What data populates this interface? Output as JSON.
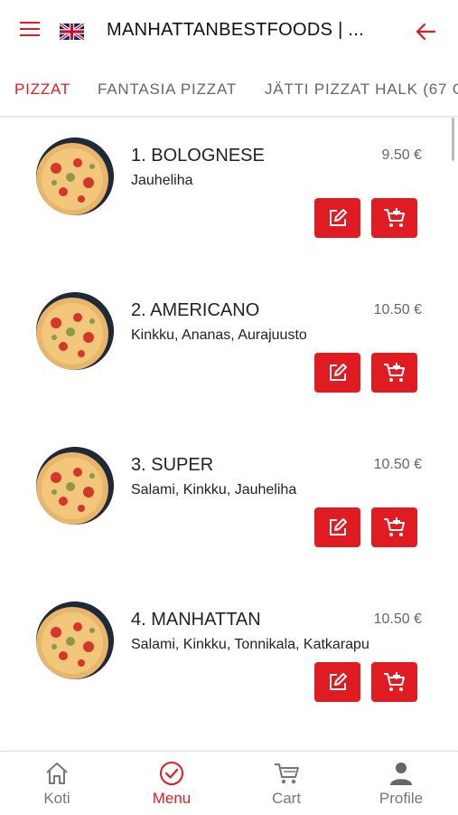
{
  "header": {
    "title": "MANHATTANBESTFOODS | ...",
    "menu_icon": "hamburger-icon",
    "language_icon": "uk-flag-icon",
    "back_icon": "arrow-left-icon"
  },
  "tabs": [
    {
      "label": "PIZZAT",
      "active": true
    },
    {
      "label": "FANTASIA PIZZAT",
      "active": false
    },
    {
      "label": "JÄTTI PIZZAT HALK (67 C",
      "active": false
    }
  ],
  "items": [
    {
      "name": "1. BOLOGNESE",
      "price": "9.50 €",
      "description": "Jauheliha"
    },
    {
      "name": "2. AMERICANO",
      "price": "10.50 €",
      "description": "Kinkku, Ananas, Aurajuusto"
    },
    {
      "name": "3. SUPER",
      "price": "10.50 €",
      "description": "Salami, Kinkku, Jauheliha"
    },
    {
      "name": "4. MANHATTAN",
      "price": "10.50 €",
      "description": "Salami, Kinkku, Tonnikala, Katkarapu"
    }
  ],
  "bottom_nav": [
    {
      "label": "Koti",
      "icon": "home-icon",
      "active": false
    },
    {
      "label": "Menu",
      "icon": "check-circle-icon",
      "active": true
    },
    {
      "label": "Cart",
      "icon": "cart-icon",
      "active": false
    },
    {
      "label": "Profile",
      "icon": "person-icon",
      "active": false
    }
  ],
  "colors": {
    "accent": "#e11b22",
    "muted": "#777777"
  }
}
